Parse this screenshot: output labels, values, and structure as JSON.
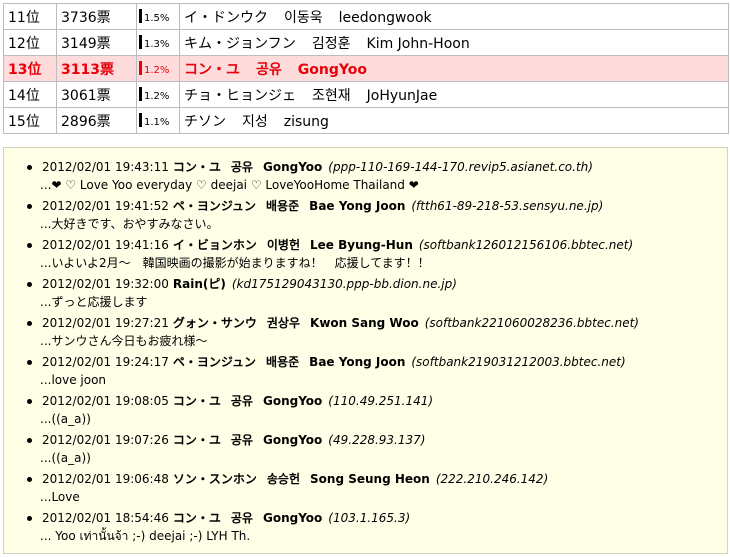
{
  "ranking": [
    {
      "rank": "11位",
      "votes": "3736票",
      "pct": "1.5%",
      "name_ja": "イ・ドンウク",
      "name_ko": "이동욱",
      "name_en": "leedongwook",
      "highlight": false
    },
    {
      "rank": "12位",
      "votes": "3149票",
      "pct": "1.3%",
      "name_ja": "キム・ジョンフン",
      "name_ko": "김정훈",
      "name_en": "Kim John-Hoon",
      "highlight": false
    },
    {
      "rank": "13位",
      "votes": "3113票",
      "pct": "1.2%",
      "name_ja": "コン・ユ",
      "name_ko": "공유",
      "name_en": "GongYoo",
      "highlight": true
    },
    {
      "rank": "14位",
      "votes": "3061票",
      "pct": "1.2%",
      "name_ja": "チョ・ヒョンジェ",
      "name_ko": "조현재",
      "name_en": "JoHyunJae",
      "highlight": false
    },
    {
      "rank": "15位",
      "votes": "2896票",
      "pct": "1.1%",
      "name_ja": "チソン",
      "name_ko": "지성",
      "name_en": "zisung",
      "highlight": false
    }
  ],
  "comments": [
    {
      "timestamp": "2012/02/01 19:43:11",
      "name_ja": "コン・ユ",
      "name_ko": "공유",
      "name_en": "GongYoo",
      "host": "(ppp-110-169-144-170.revip5.asianet.co.th)",
      "message": "...❤ ♡ Love Yoo everyday ♡ deejai ♡ LoveYooHome Thailand ❤"
    },
    {
      "timestamp": "2012/02/01 19:41:52",
      "name_ja": "ペ・ヨンジュン",
      "name_ko": "배용준",
      "name_en": "Bae Yong Joon",
      "host": "(ftth61-89-218-53.sensyu.ne.jp)",
      "message": "...大好きです、おやすみなさい。"
    },
    {
      "timestamp": "2012/02/01 19:41:16",
      "name_ja": "イ・ビョンホン",
      "name_ko": "이병헌",
      "name_en": "Lee Byung-Hun",
      "host": "(softbank126012156106.bbtec.net)",
      "message": "...いよいよ2月～　韓国映画の撮影が始まりますね！　応援してます！！"
    },
    {
      "timestamp": "2012/02/01 19:32:00",
      "name_ja": "Rain(ピ)",
      "name_ko": "",
      "name_en": "",
      "host": "(kd175129043130.ppp-bb.dion.ne.jp)",
      "message": "...ずっと応援します"
    },
    {
      "timestamp": "2012/02/01 19:27:21",
      "name_ja": "グォン・サンウ",
      "name_ko": "권상우",
      "name_en": "Kwon Sang Woo",
      "host": "(softbank221060028236.bbtec.net)",
      "message": "...サンウさん今日もお疲れ様～"
    },
    {
      "timestamp": "2012/02/01 19:24:17",
      "name_ja": "ペ・ヨンジュン",
      "name_ko": "배용준",
      "name_en": "Bae Yong Joon",
      "host": "(softbank219031212003.bbtec.net)",
      "message": "...love joon"
    },
    {
      "timestamp": "2012/02/01 19:08:05",
      "name_ja": "コン・ユ",
      "name_ko": "공유",
      "name_en": "GongYoo",
      "host": "(110.49.251.141)",
      "message": "...((a_a))"
    },
    {
      "timestamp": "2012/02/01 19:07:26",
      "name_ja": "コン・ユ",
      "name_ko": "공유",
      "name_en": "GongYoo",
      "host": "(49.228.93.137)",
      "message": "...((a_a))"
    },
    {
      "timestamp": "2012/02/01 19:06:48",
      "name_ja": "ソン・スンホン",
      "name_ko": "송승헌",
      "name_en": "Song Seung Heon",
      "host": "(222.210.246.142)",
      "message": "...Love"
    },
    {
      "timestamp": "2012/02/01 18:54:46",
      "name_ja": "コン・ユ",
      "name_ko": "공유",
      "name_en": "GongYoo",
      "host": "(103.1.165.3)",
      "message": "... Yoo เท่านั้นจ้า ;-) deejai ;-) LYH Th."
    }
  ],
  "colors": {
    "highlight_text": "#e8000b",
    "highlight_bg": "#ffdcdc",
    "comment_bg": "#ffffe8"
  }
}
